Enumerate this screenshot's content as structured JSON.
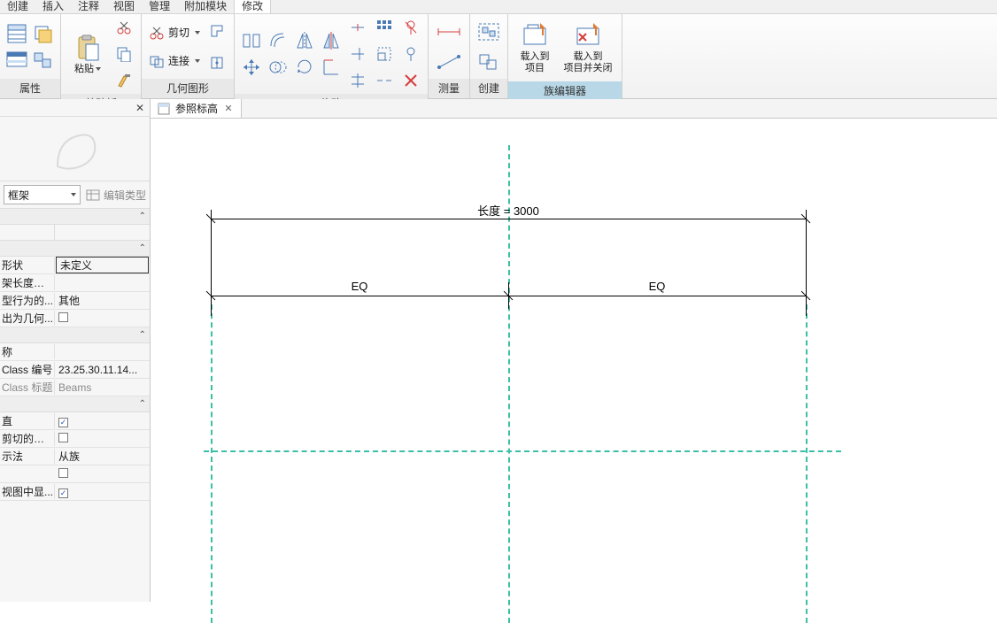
{
  "tabs": {
    "items": [
      "创建",
      "插入",
      "注释",
      "视图",
      "管理",
      "附加模块",
      "修改"
    ],
    "active_index": 6
  },
  "ribbon": {
    "panels": {
      "properties": {
        "title": "属性"
      },
      "clipboard": {
        "title": "剪贴板",
        "paste": "粘贴"
      },
      "geometry": {
        "title": "几何图形",
        "cut": "剪切",
        "join": "连接"
      },
      "modify": {
        "title": "修改"
      },
      "measure": {
        "title": "测量"
      },
      "create": {
        "title": "创建"
      },
      "family_editor": {
        "title": "族编辑器",
        "load_project_l1": "载入到",
        "load_project_l2": "项目",
        "load_close_l1": "载入到",
        "load_close_l2": "项目并关闭"
      }
    }
  },
  "view_tab": {
    "label": "参照标高"
  },
  "type_selector": {
    "value": "框架",
    "edit_type": "编辑类型"
  },
  "props": {
    "sect1": [
      {
        "k": "形状",
        "v": "未定义",
        "boxed": true
      },
      {
        "k": "架长度舍入",
        "v": ""
      },
      {
        "k": "型行为的...",
        "v": "其他"
      },
      {
        "k": "出为几何...",
        "chk": false
      }
    ],
    "sect2_title": "",
    "sect2": [
      {
        "k": "称",
        "v": ""
      },
      {
        "k": "Class 编号",
        "v": "23.25.30.11.14..."
      },
      {
        "k": "Class 标题",
        "v": "Beams"
      }
    ],
    "sect3": [
      {
        "k": "直",
        "chk": true
      },
      {
        "k": "剪切的空心",
        "chk": false
      },
      {
        "k": "示法",
        "v": "从族"
      },
      {
        "k": "",
        "chk": false
      },
      {
        "k": "视图中显...",
        "chk": true
      }
    ]
  },
  "canvas": {
    "length_label": "长度 = 3000",
    "eq_left": "EQ",
    "eq_right": "EQ"
  }
}
